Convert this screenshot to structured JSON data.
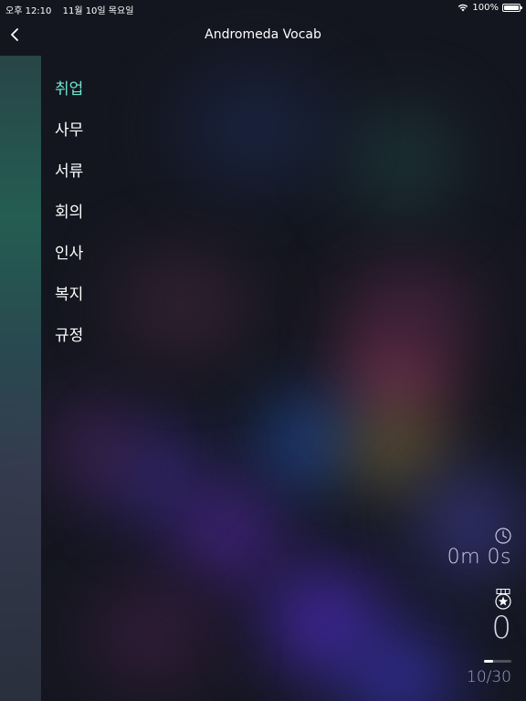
{
  "status_bar": {
    "time": "오후 12:10",
    "date": "11월 10일 목요일",
    "battery": "100%",
    "battery_level": 1.0
  },
  "nav": {
    "title": "Andromeda Vocab",
    "back_icon": "chevron-left-icon"
  },
  "menu": {
    "items": [
      {
        "label": "취업",
        "active": true
      },
      {
        "label": "사무",
        "active": false
      },
      {
        "label": "서류",
        "active": false
      },
      {
        "label": "회의",
        "active": false
      },
      {
        "label": "인사",
        "active": false
      },
      {
        "label": "복지",
        "active": false
      },
      {
        "label": "규정",
        "active": false
      }
    ]
  },
  "stats": {
    "time_icon": "clock-icon",
    "time_value": "0m 0s",
    "score_icon": "medal-star-icon",
    "score_value": "0",
    "progress_text": "10/30",
    "progress_fraction": 0.333
  },
  "colors": {
    "accent": "#6fe3cf",
    "text": "#ffffff"
  }
}
